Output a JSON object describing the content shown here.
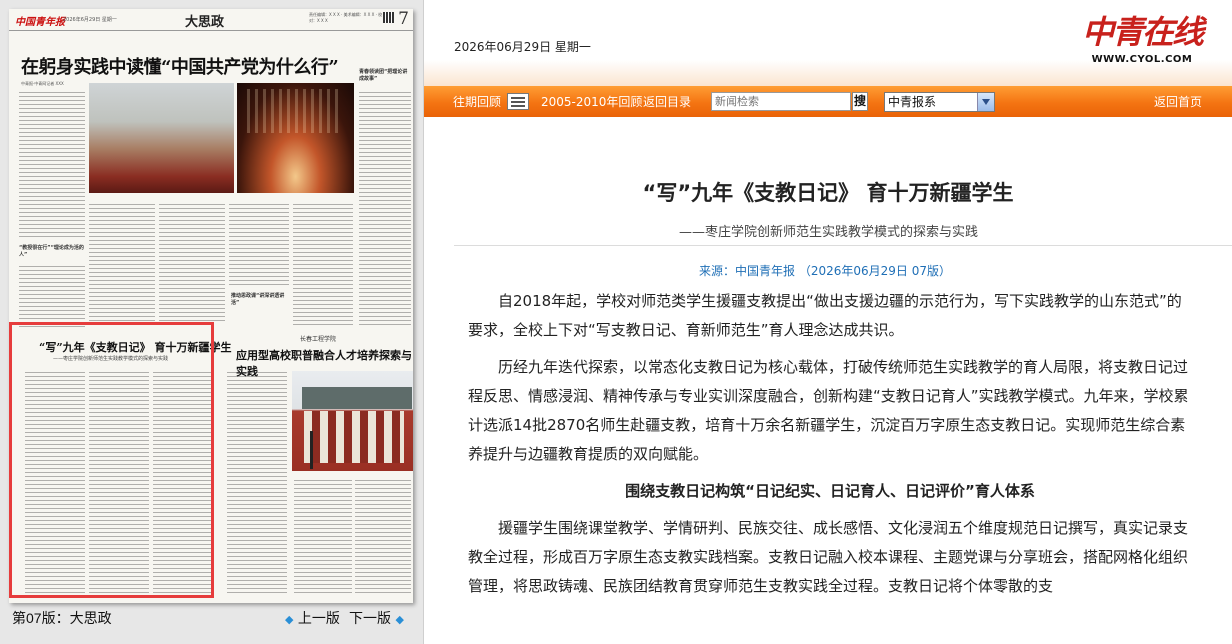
{
  "paper": {
    "logo": "中国青年报",
    "date_line": "2026年6月29日 星期一",
    "section": "大思政",
    "editors": "责任编辑：X X X · 美术编辑：X X X · 校对：X X X",
    "page_number": "7",
    "headline1": "在躬身实践中读懂“中国共产党为什么行”",
    "byline1": "中青报·中青网记者  XXX",
    "subhead_left": "“教授很在行”“理论成为活的人”",
    "subhead_right": "青春领读团“把理论讲成故事”",
    "subhead_mid": "推动思政课“讲深讲透讲活”",
    "article1_headline": "“写”九年《支教日记》 育十万新疆学生",
    "article1_subtitle": "——枣庄学院创新师范生实践教学模式的探索与实践",
    "article2_kicker": "长春工程学院",
    "article2_headline": "应用型高校职普融合人才培养探索与实践",
    "footer_label": "第07版：大思政",
    "prev_page": "上一版",
    "next_page": "下一版"
  },
  "site": {
    "date": "2026年06月29日 星期一",
    "logo_mark": "中青在线",
    "logo_url": "WWW.CYOL.COM",
    "nav": {
      "past_issues": "往期回顾",
      "archive": "2005-2010年回顾",
      "back_to_list": "返回目录",
      "search_placeholder": "新闻检索",
      "search_button": "搜",
      "select_value": "中青报系",
      "home": "返回首页"
    },
    "colors": {
      "nav_orange": "#f47412",
      "logo_red": "#c8211c",
      "source_blue": "#1f6fb6",
      "highlight_red": "#e63c3c"
    }
  },
  "article": {
    "title": "“写”九年《支教日记》 育十万新疆学生",
    "subtitle": "——枣庄学院创新师范生实践教学模式的探索与实践",
    "source": "来源：中国青年报      （2026年06月29日  07版）",
    "paragraphs": [
      "自2018年起，学校对师范类学生援疆支教提出“做出支援边疆的示范行为，写下实践教学的山东范式”的要求，全校上下对“写支教日记、育新师范生”育人理念达成共识。",
      "历经九年迭代探索，以常态化支教日记为核心载体，打破传统师范生实践教学的育人局限，将支教日记过程反思、情感浸润、精神传承与专业实训深度融合，创新构建“支教日记育人”实践教学模式。九年来，学校累计选派14批2870名师生赴疆支教，培育十万余名新疆学生，沉淀百万字原生态支教日记。实现师范生综合素养提升与边疆教育提质的双向赋能。"
    ],
    "section_heading": "围绕支教日记构筑“日记纪实、日记育人、日记评价”育人体系",
    "paragraph3": "援疆学生围绕课堂教学、学情研判、民族交往、成长感悟、文化浸润五个维度规范日记撰写，真实记录支教全过程，形成百万字原生态支教实践档案。支教日记融入校本课程、主题党课与分享班会，搭配网格化组织管理，将思政铸魂、民族团结教育贯穿师范生支教实践全过程。支教日记将个体零散的支"
  }
}
